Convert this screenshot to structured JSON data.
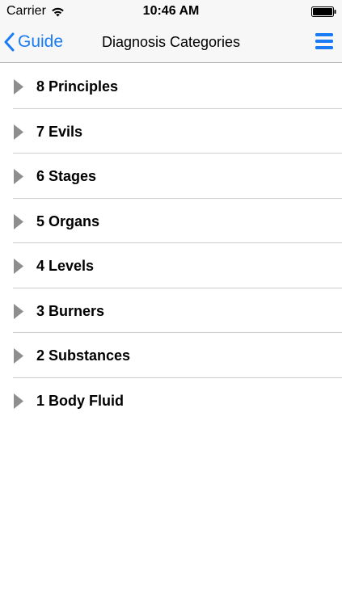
{
  "status_bar": {
    "carrier": "Carrier",
    "time": "10:46 AM"
  },
  "nav_bar": {
    "back_label": "Guide",
    "title": "Diagnosis Categories",
    "accent_color": "#1a7cf5"
  },
  "icons": {
    "back": "chevron-left-icon",
    "menu": "hamburger-menu-icon",
    "row": "disclosure-triangle-icon",
    "wifi": "wifi-icon",
    "battery": "battery-icon"
  },
  "categories": [
    {
      "label": "8 Principles"
    },
    {
      "label": "7 Evils"
    },
    {
      "label": "6 Stages"
    },
    {
      "label": "5 Organs"
    },
    {
      "label": "4 Levels"
    },
    {
      "label": "3 Burners"
    },
    {
      "label": "2 Substances"
    },
    {
      "label": "1 Body Fluid"
    }
  ]
}
